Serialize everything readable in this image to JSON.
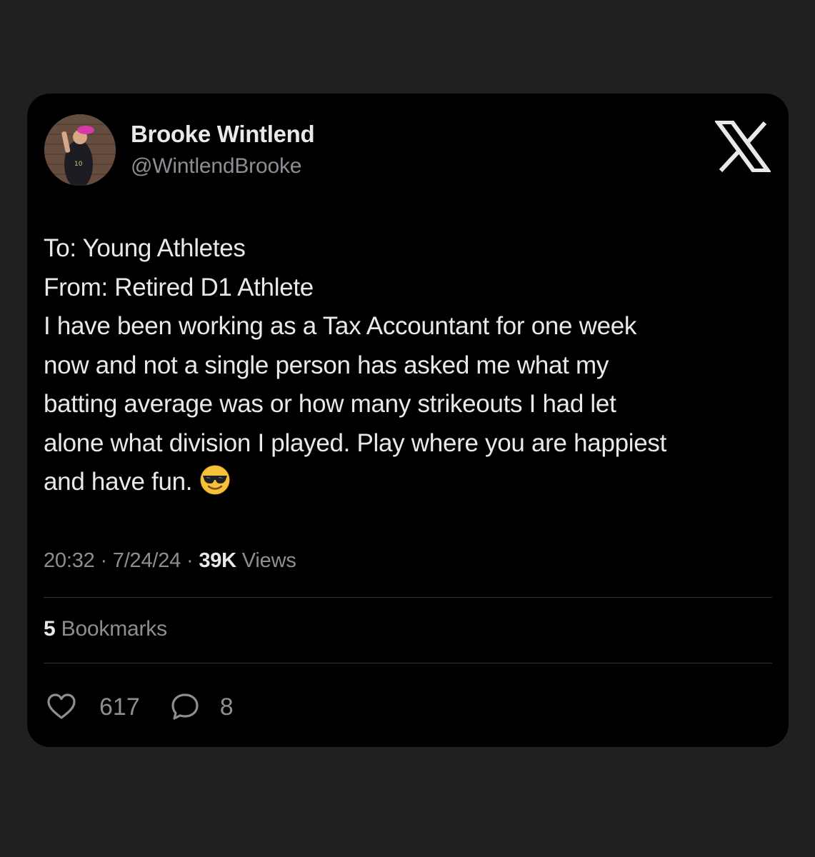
{
  "author": {
    "name": "Brooke Wintlend",
    "handle": "@WintlendBrooke",
    "avatar_icon": "avatar"
  },
  "platform_logo_icon": "x-logo-icon",
  "tweet": {
    "lines": [
      "To: Young Athletes",
      "From: Retired D1 Athlete",
      "I have been working as a Tax Accountant for one week",
      "now and not a single person has asked me what my",
      "batting average was or how many strikeouts I had let",
      "alone what division I played. Play where you are happiest",
      "and have fun."
    ],
    "emoji": "smiling-face-with-sunglasses-emoji"
  },
  "meta": {
    "time": "20:32",
    "separator": "·",
    "date": "7/24/24",
    "views_count": "39K",
    "views_label": "Views"
  },
  "bookmarks": {
    "count": "5",
    "label": "Bookmarks"
  },
  "actions": {
    "like_icon": "heart-icon",
    "like_count": "617",
    "reply_icon": "reply-icon",
    "reply_count": "8"
  },
  "colors": {
    "page_background": "#202020",
    "card_background": "#000000",
    "primary_text": "#e7e9ea",
    "secondary_text": "#8b8f93",
    "divider": "#2f3336"
  }
}
